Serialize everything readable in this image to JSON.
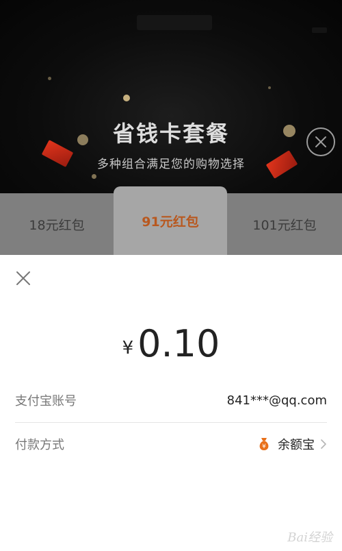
{
  "promo": {
    "title": "省钱卡套餐",
    "subtitle": "多种组合满足您的购物选择"
  },
  "options": [
    {
      "label": "18元红包",
      "selected": false
    },
    {
      "label": "91元红包",
      "selected": true
    },
    {
      "label": "101元红包",
      "selected": false
    }
  ],
  "payment": {
    "currency_symbol": "¥",
    "amount": "0.10",
    "account_label": "支付宝账号",
    "account_value": "841***@qq.com",
    "method_label": "付款方式",
    "method_value": "余额宝",
    "method_icon": "money-bag-icon"
  },
  "watermark": "Bai经验",
  "colors": {
    "accent": "#b8581f",
    "icon_orange": "#e8701a",
    "overlay_dark": "#0c0c0c",
    "tab_strip": "#7f7f7f"
  }
}
